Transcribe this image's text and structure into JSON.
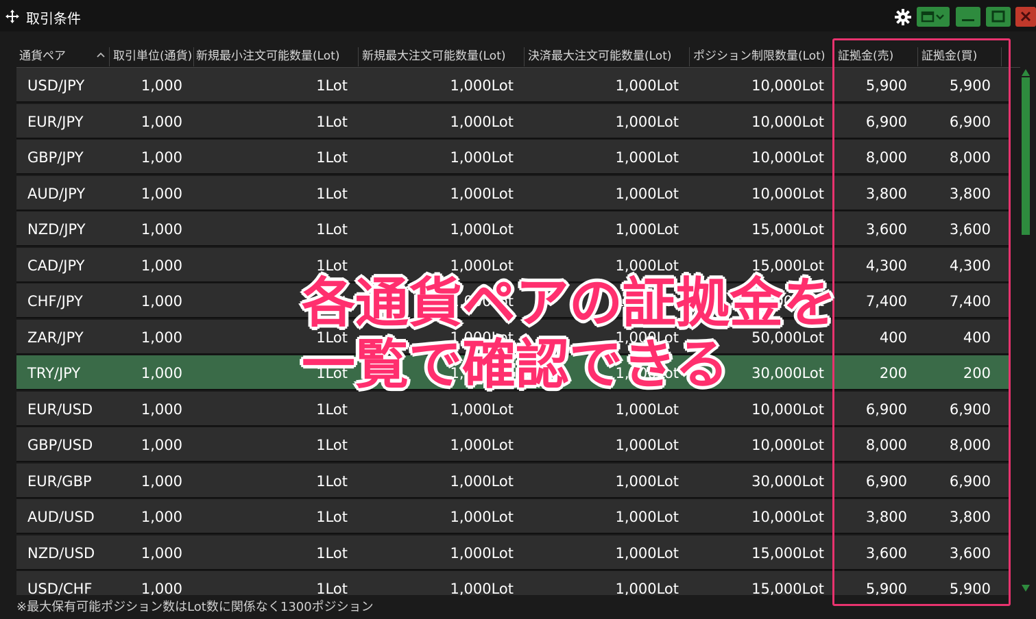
{
  "window": {
    "title": "取引条件"
  },
  "colors": {
    "accent": "#2e8b3e",
    "highlight_row": "#3a6b48",
    "annotation": "#e8336e"
  },
  "columns": [
    "通貨ペア",
    "取引単位(通貨)",
    "新規最小注文可能数量(Lot)",
    "新規最大注文可能数量(Lot)",
    "決済最大注文可能数量(Lot)",
    "ポジション制限数量(Lot)",
    "証拠金(売)",
    "証拠金(買)"
  ],
  "rows": [
    {
      "pair": "USD/JPY",
      "unit": "1,000",
      "min": "1Lot",
      "max": "1,000Lot",
      "settle": "1,000Lot",
      "limit": "10,000Lot",
      "sell": "5,900",
      "buy": "5,900"
    },
    {
      "pair": "EUR/JPY",
      "unit": "1,000",
      "min": "1Lot",
      "max": "1,000Lot",
      "settle": "1,000Lot",
      "limit": "10,000Lot",
      "sell": "6,900",
      "buy": "6,900"
    },
    {
      "pair": "GBP/JPY",
      "unit": "1,000",
      "min": "1Lot",
      "max": "1,000Lot",
      "settle": "1,000Lot",
      "limit": "10,000Lot",
      "sell": "8,000",
      "buy": "8,000"
    },
    {
      "pair": "AUD/JPY",
      "unit": "1,000",
      "min": "1Lot",
      "max": "1,000Lot",
      "settle": "1,000Lot",
      "limit": "10,000Lot",
      "sell": "3,800",
      "buy": "3,800"
    },
    {
      "pair": "NZD/JPY",
      "unit": "1,000",
      "min": "1Lot",
      "max": "1,000Lot",
      "settle": "1,000Lot",
      "limit": "15,000Lot",
      "sell": "3,600",
      "buy": "3,600"
    },
    {
      "pair": "CAD/JPY",
      "unit": "1,000",
      "min": "1Lot",
      "max": "1,000Lot",
      "settle": "1,000Lot",
      "limit": "15,000Lot",
      "sell": "4,300",
      "buy": "4,300"
    },
    {
      "pair": "CHF/JPY",
      "unit": "1,000",
      "min": "1Lot",
      "max": "1,000Lot",
      "settle": "1,000Lot",
      "limit": "10,000Lot",
      "sell": "7,400",
      "buy": "7,400"
    },
    {
      "pair": "ZAR/JPY",
      "unit": "1,000",
      "min": "1Lot",
      "max": "1,000Lot",
      "settle": "1,000Lot",
      "limit": "50,000Lot",
      "sell": "400",
      "buy": "400"
    },
    {
      "pair": "TRY/JPY",
      "unit": "1,000",
      "min": "1Lot",
      "max": "1,000Lot",
      "settle": "1,000Lot",
      "limit": "30,000Lot",
      "sell": "200",
      "buy": "200",
      "selected": true
    },
    {
      "pair": "EUR/USD",
      "unit": "1,000",
      "min": "1Lot",
      "max": "1,000Lot",
      "settle": "1,000Lot",
      "limit": "10,000Lot",
      "sell": "6,900",
      "buy": "6,900"
    },
    {
      "pair": "GBP/USD",
      "unit": "1,000",
      "min": "1Lot",
      "max": "1,000Lot",
      "settle": "1,000Lot",
      "limit": "10,000Lot",
      "sell": "8,000",
      "buy": "8,000"
    },
    {
      "pair": "EUR/GBP",
      "unit": "1,000",
      "min": "1Lot",
      "max": "1,000Lot",
      "settle": "1,000Lot",
      "limit": "30,000Lot",
      "sell": "6,900",
      "buy": "6,900"
    },
    {
      "pair": "AUD/USD",
      "unit": "1,000",
      "min": "1Lot",
      "max": "1,000Lot",
      "settle": "1,000Lot",
      "limit": "10,000Lot",
      "sell": "3,800",
      "buy": "3,800"
    },
    {
      "pair": "NZD/USD",
      "unit": "1,000",
      "min": "1Lot",
      "max": "1,000Lot",
      "settle": "1,000Lot",
      "limit": "15,000Lot",
      "sell": "3,600",
      "buy": "3,600"
    },
    {
      "pair": "USD/CHF",
      "unit": "1,000",
      "min": "1Lot",
      "max": "1,000Lot",
      "settle": "1,000Lot",
      "limit": "15,000Lot",
      "sell": "5,900",
      "buy": "5,900"
    }
  ],
  "footer_note": "※最大保有可能ポジション数はLot数に関係なく1300ポジション",
  "annotation": {
    "line1": "各通貨ペアの証拠金を",
    "line2": "一覧で確認できる"
  }
}
